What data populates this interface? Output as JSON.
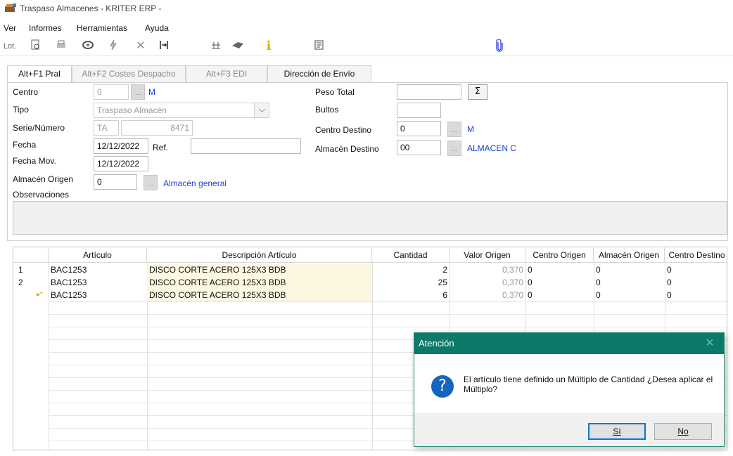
{
  "window": {
    "title": "Traspaso Almacenes - KRITER ERP -"
  },
  "menu": [
    "Ver",
    "Informes",
    "Herramientas",
    "Ayuda"
  ],
  "toolbar": {
    "lot_label": "Lot.",
    "info_glyph": "i"
  },
  "tabs": [
    "Alt+F1 Pral",
    "Alt+F2 Costes Despacho",
    "Alt+F3 EDI",
    "Dirección de Envío"
  ],
  "form": {
    "centro": {
      "label": "Centro",
      "value": "0",
      "link": "M"
    },
    "tipo": {
      "label": "Tipo",
      "value": "Traspaso Almacén"
    },
    "serie": {
      "label": "Serie/Número",
      "serie": "TA",
      "numero": "8471"
    },
    "fecha": {
      "label": "Fecha",
      "value": "12/12/2022",
      "ref_label": "Ref.",
      "ref_value": ""
    },
    "fecha_mov": {
      "label": "Fecha Mov.",
      "value": "12/12/2022"
    },
    "almacen_origen": {
      "label": "Almacén Origen",
      "value": "0",
      "link": "Almacén general"
    },
    "observaciones": {
      "label": "Observaciones"
    },
    "peso_total": {
      "label": "Peso Total",
      "value": "",
      "sum_glyph": "Σ"
    },
    "bultos": {
      "label": "Bultos",
      "value": ""
    },
    "centro_destino": {
      "label": "Centro Destino",
      "value": "0",
      "link": "M"
    },
    "almacen_destino": {
      "label": "Almacén Destino",
      "value": "00",
      "link": "ALMACEN C"
    },
    "ellipsis": "..."
  },
  "grid": {
    "headers": [
      "Artículo",
      "Descripción Artículo",
      "Cantidad",
      "Valor Origen",
      "Centro Origen",
      "Almacén Origen",
      "Centro Destino"
    ],
    "rows": [
      {
        "n": "1",
        "articulo": "BAC1253",
        "descripcion": "DISCO CORTE ACERO 125X3 BDB",
        "cantidad": "2",
        "valor": "0,370",
        "centro_origen": "0",
        "almacen_origen": "0",
        "centro_destino": "0"
      },
      {
        "n": "2",
        "articulo": "BAC1253",
        "descripcion": "DISCO CORTE ACERO 125X3 BDB",
        "cantidad": "25",
        "valor": "0,370",
        "centro_origen": "0",
        "almacen_origen": "0",
        "centro_destino": "0"
      },
      {
        "n": "",
        "articulo": "BAC1253",
        "descripcion": "DISCO CORTE ACERO 125X3 BDB",
        "cantidad": "6",
        "valor": "0,370",
        "centro_origen": "0",
        "almacen_origen": "0",
        "centro_destino": "0"
      }
    ],
    "current_row_marker": "▸*"
  },
  "dialog": {
    "title": "Atención",
    "message": "El artículo tiene definido un Múltiplo de Cantidad ¿Desea aplicar el Múltiplo?",
    "yes": "Sí",
    "no": "No",
    "close_glyph": "✕",
    "icon_glyph": "?"
  }
}
